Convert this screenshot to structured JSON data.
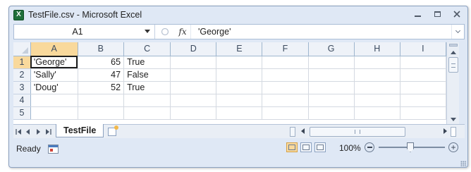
{
  "window": {
    "title": "TestFile.csv - Microsoft Excel",
    "app_icon_letter": "X"
  },
  "formula_bar": {
    "name_box": "A1",
    "fx_label": "fx",
    "content": "'George'"
  },
  "sheet": {
    "columns": [
      "A",
      "B",
      "C",
      "D",
      "E",
      "F",
      "G",
      "H",
      "I"
    ],
    "active_column": "A",
    "active_row": "1",
    "rows": [
      {
        "num": "1",
        "cells": [
          "'George'",
          "65",
          "True",
          "",
          "",
          "",
          "",
          "",
          ""
        ]
      },
      {
        "num": "2",
        "cells": [
          "'Sally'",
          "47",
          "False",
          "",
          "",
          "",
          "",
          "",
          ""
        ]
      },
      {
        "num": "3",
        "cells": [
          "'Doug'",
          "52",
          "True",
          "",
          "",
          "",
          "",
          "",
          ""
        ]
      },
      {
        "num": "4",
        "cells": [
          "",
          "",
          "",
          "",
          "",
          "",
          "",
          "",
          ""
        ]
      },
      {
        "num": "5",
        "cells": [
          "",
          "",
          "",
          "",
          "",
          "",
          "",
          "",
          ""
        ]
      }
    ]
  },
  "tabs": {
    "sheet_name": "TestFile"
  },
  "status_bar": {
    "status": "Ready",
    "zoom": "100%"
  },
  "colors": {
    "window_bg": "#dfe8f5",
    "header_active": "#f9d99c",
    "excel_green": "#1f6f3a"
  }
}
